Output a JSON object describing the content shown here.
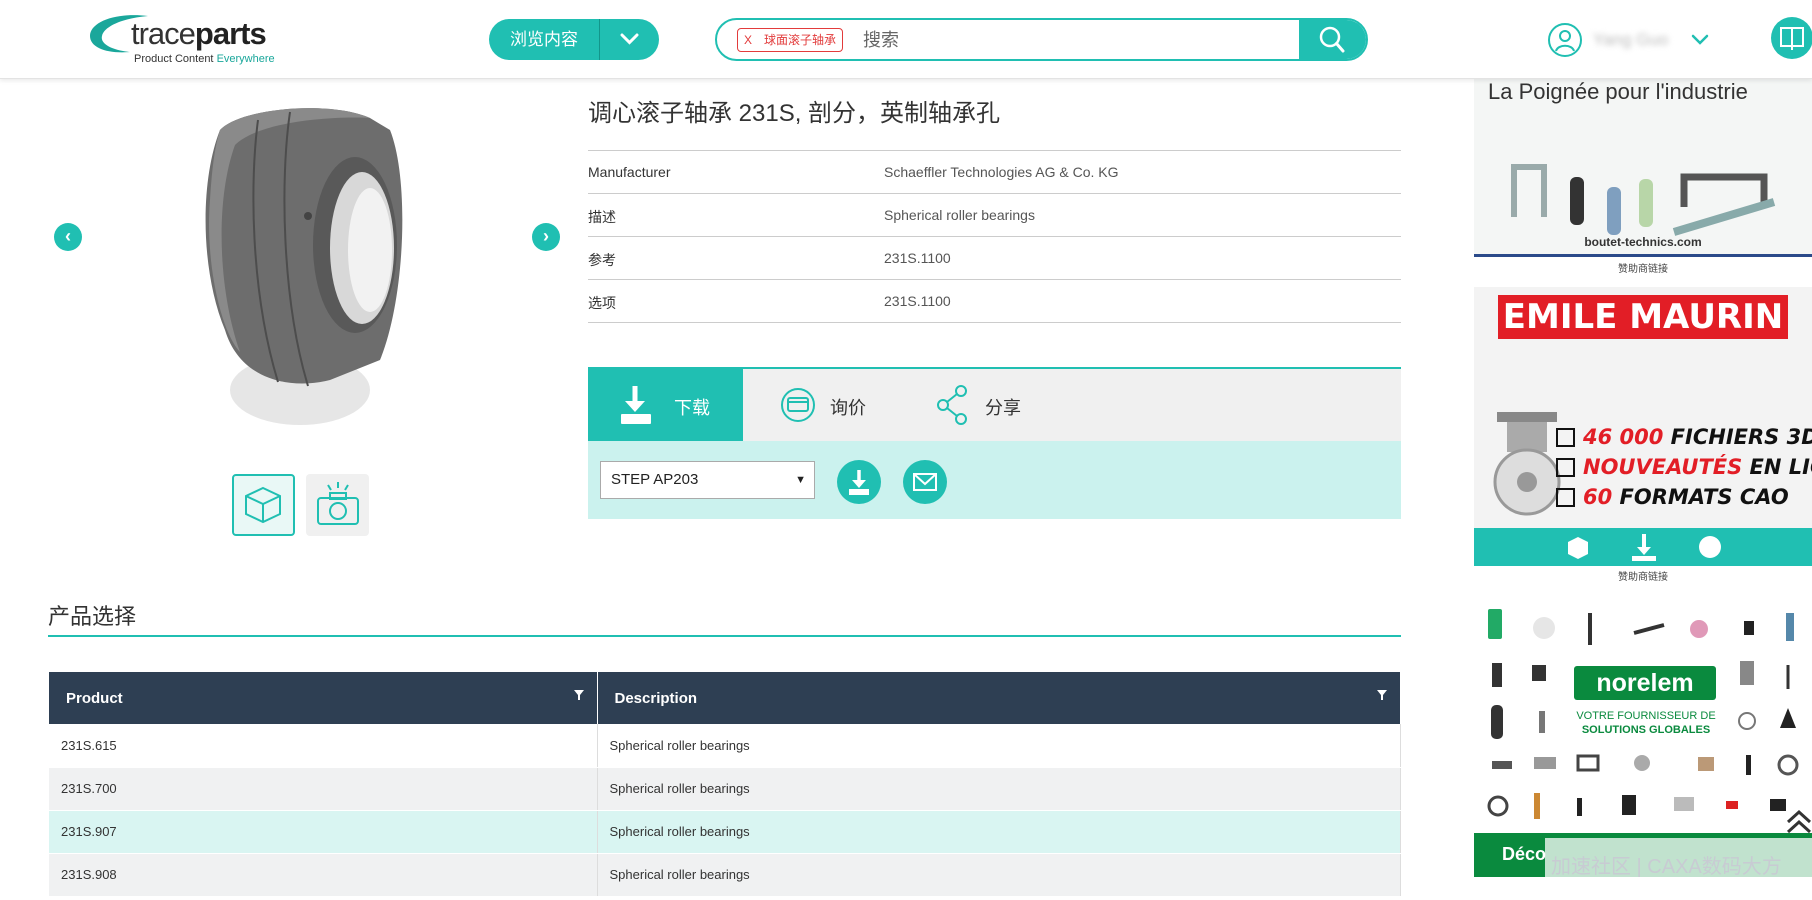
{
  "header": {
    "logo_word_light": "trace",
    "logo_word_bold": "parts",
    "logo_tagline_plain": "Product Content ",
    "logo_tagline_accent": "Everywhere",
    "browse_label": "浏览内容",
    "search_tag": "球面滚子轴承",
    "search_tag_remove": "X",
    "search_placeholder": "搜索",
    "user_name": "Yang Guo"
  },
  "product": {
    "title": "调心滚子轴承 231S, 剖分，英制轴承孔",
    "details": [
      {
        "key": "Manufacturer",
        "value": "Schaeffler Technologies AG & Co. KG"
      },
      {
        "key": "描述",
        "value": "Spherical roller bearings"
      },
      {
        "key": "参考",
        "value": "231S.1100"
      },
      {
        "key": "选项",
        "value": "231S.1100"
      }
    ]
  },
  "actions": {
    "tabs": {
      "download": "下载",
      "quote": "询价",
      "share": "分享"
    },
    "format_selected": "STEP AP203"
  },
  "selection": {
    "title": "产品选择",
    "columns": [
      "Product",
      "Description"
    ],
    "rows": [
      {
        "product": "231S.615",
        "description": "Spherical roller bearings"
      },
      {
        "product": "231S.700",
        "description": "Spherical roller bearings"
      },
      {
        "product": "231S.907",
        "description": "Spherical roller bearings"
      },
      {
        "product": "231S.908",
        "description": "Spherical roller bearings"
      }
    ]
  },
  "sidebar": {
    "ad1_headline": "La Poignée pour l'industrie",
    "ad1_site": "boutet-technics.com",
    "sponsor_label": "赞助商链接",
    "ad2_brand": "EMILE MAURIN",
    "ad2_lines": [
      {
        "num": "46 000",
        "text": " FICHIERS 3D"
      },
      {
        "num": "NOUVEAUTÉS",
        "text": " EN LIGNE"
      },
      {
        "num": "60",
        "text": " FORMATS CAO"
      }
    ],
    "ad3_brand": "norelem",
    "ad3_sub1": "VOTRE FOURNISSEUR DE",
    "ad3_sub2": "SOLUTIONS GLOBALES",
    "ad3_cta": "Déco",
    "watermark": "加速社区 | CAXA数码大方"
  },
  "colors": {
    "accent": "#20bfb2",
    "table_header": "#2e3f53",
    "emile_red": "#e21e26",
    "norelem_green": "#0a8a3e"
  }
}
